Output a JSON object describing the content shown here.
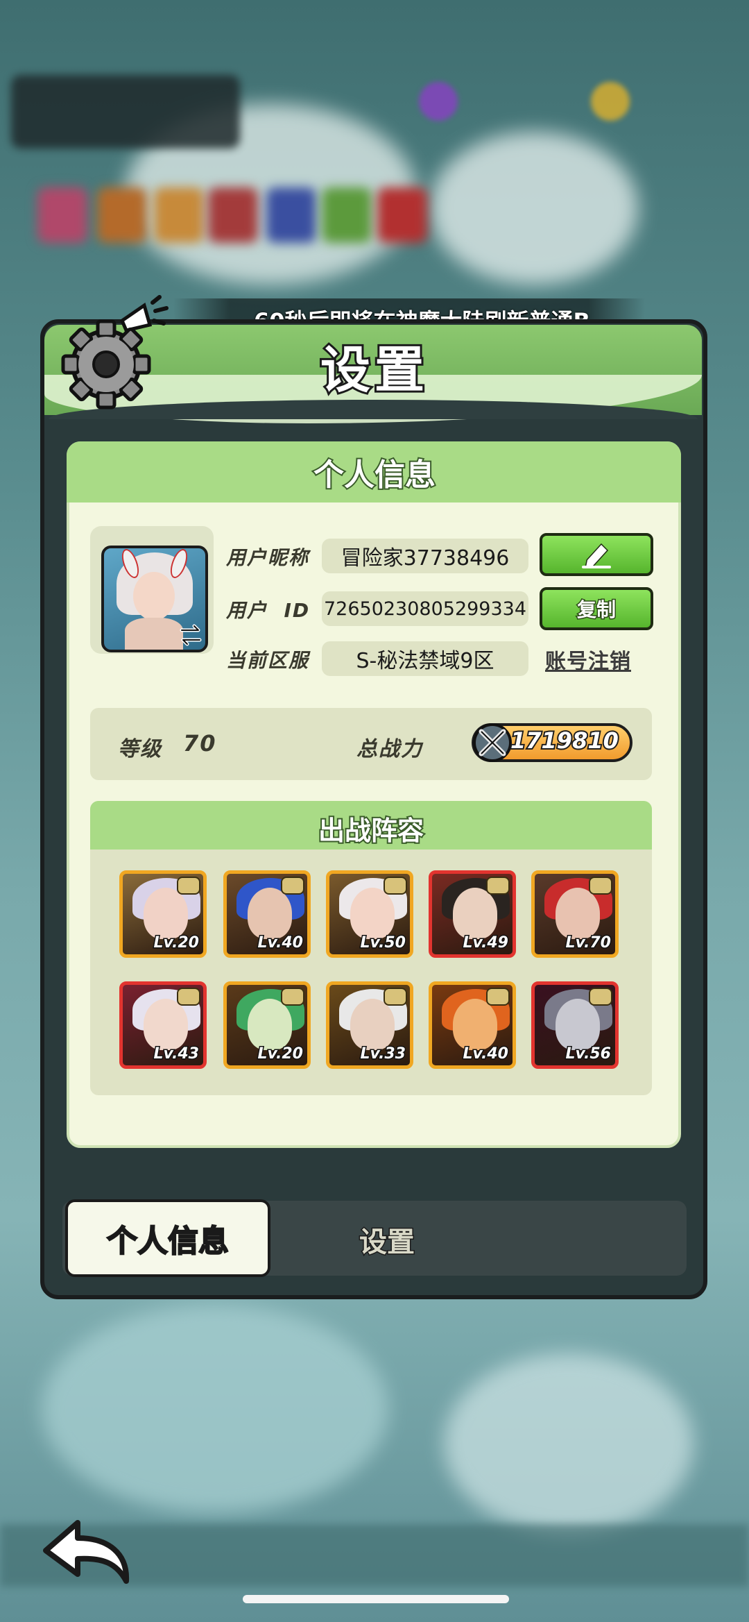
{
  "marquee": {
    "text": "60秒后即将在神魔大陆刷新普通B"
  },
  "dialog": {
    "title": "设置"
  },
  "profile": {
    "section_title": "个人信息",
    "nickname_label": "用户昵称",
    "nickname_value": "冒险家37738496",
    "id_label": "用户  ID",
    "id_value": "7265023080529933​4",
    "server_label": "当前区服",
    "server_value": "S-秘法禁域9区",
    "copy_button": "复制",
    "cancel_account_link": "账号注销"
  },
  "stats": {
    "level_label": "等级",
    "level_value": "70",
    "power_label": "总战力",
    "power_value": "1719810"
  },
  "lineup": {
    "section_title": "出战阵容",
    "heroes": [
      {
        "lv": "Lv.20",
        "frame": "gold"
      },
      {
        "lv": "Lv.40",
        "frame": "gold"
      },
      {
        "lv": "Lv.50",
        "frame": "gold"
      },
      {
        "lv": "Lv.49",
        "frame": "red"
      },
      {
        "lv": "Lv.70",
        "frame": "gold"
      },
      {
        "lv": "Lv.43",
        "frame": "red"
      },
      {
        "lv": "Lv.20",
        "frame": "gold"
      },
      {
        "lv": "Lv.33",
        "frame": "gold"
      },
      {
        "lv": "Lv.40",
        "frame": "gold"
      },
      {
        "lv": "Lv.56",
        "frame": "red"
      }
    ]
  },
  "tabs": {
    "active": "个人信息",
    "inactive": "设置"
  },
  "colors": {
    "header_green": "#8cc86f",
    "content_bg": "#f3f7df",
    "button_green": "#56b52d",
    "frame_gold": "#f0a722",
    "frame_red": "#e2342f"
  }
}
